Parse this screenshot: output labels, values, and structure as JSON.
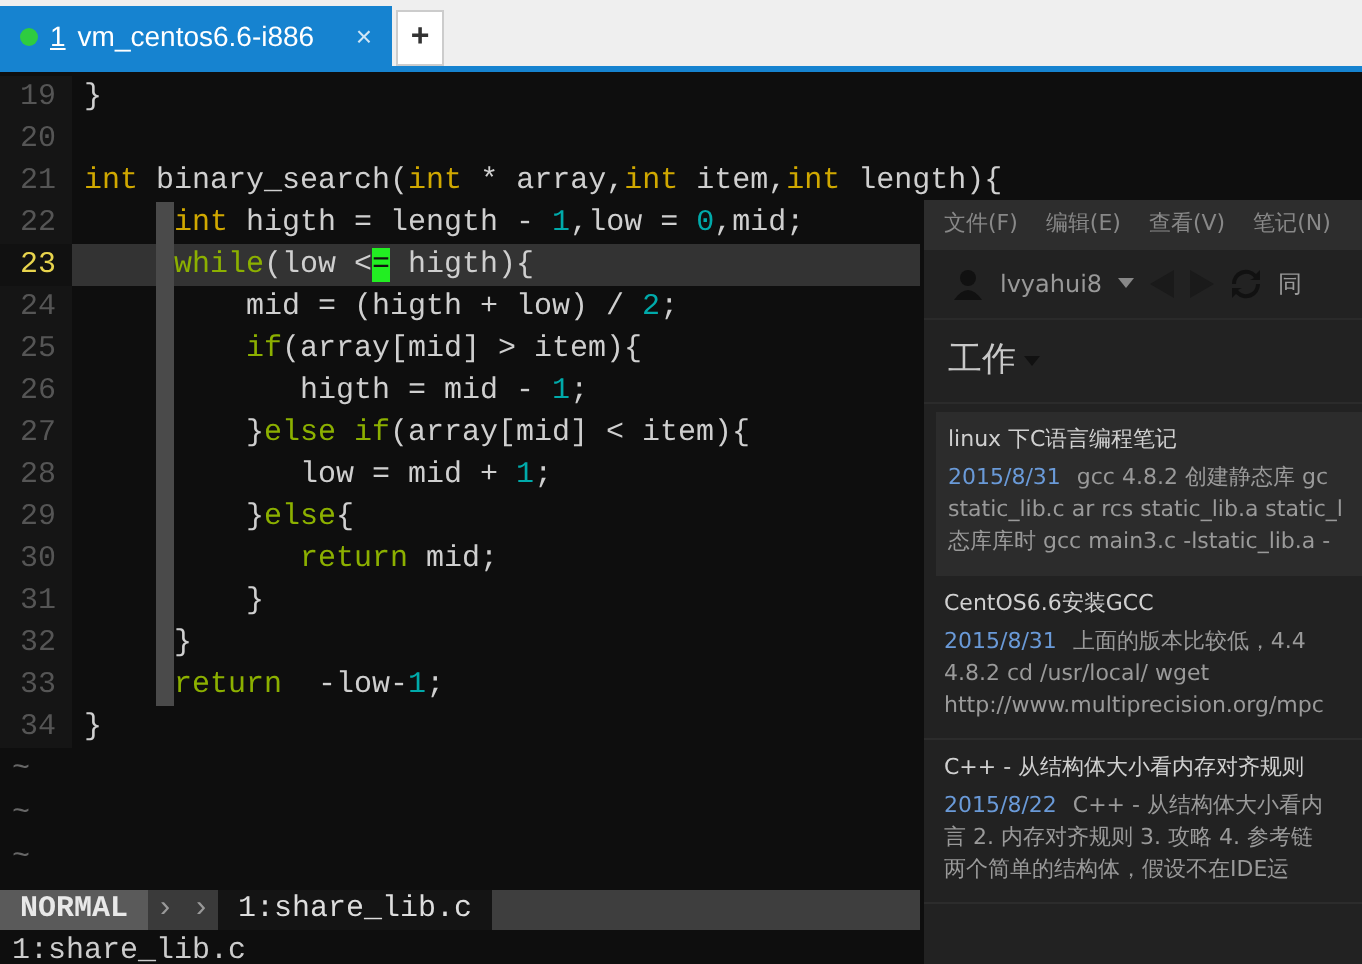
{
  "tabs": [
    {
      "number": "1",
      "label": "vm_centos6.6-i886",
      "selected": true,
      "close": "×"
    },
    {
      "label": "+",
      "selected": false,
      "kind": "new"
    }
  ],
  "editor": {
    "lines": [
      {
        "number": "19",
        "current": false,
        "guide": false,
        "tokens": [
          {
            "t": "}",
            "kind": "plain"
          }
        ]
      },
      {
        "number": "20",
        "current": false,
        "guide": false
      },
      {
        "number": "21",
        "current": false,
        "guide": false,
        "tokens": [
          {
            "t": "int",
            "kind": "type"
          },
          {
            "t": " binary_search(",
            "kind": "plain"
          },
          {
            "t": "int",
            "kind": "type"
          },
          {
            "t": " * array,",
            "kind": "plain"
          },
          {
            "t": "int",
            "kind": "type"
          },
          {
            "t": " item,",
            "kind": "plain"
          },
          {
            "t": "int",
            "kind": "type"
          },
          {
            "t": " length){",
            "kind": "plain"
          }
        ]
      },
      {
        "number": "22",
        "current": false,
        "guide": true,
        "tokens": [
          {
            "t": "     int",
            "kind": "type"
          },
          {
            "t": " higth = length - ",
            "kind": "plain"
          },
          {
            "t": "1",
            "kind": "num"
          },
          {
            "t": ",low = ",
            "kind": "plain"
          },
          {
            "t": "0",
            "kind": "num"
          },
          {
            "t": ",mid;",
            "kind": "plain"
          }
        ]
      },
      {
        "number": "23",
        "current": true,
        "guide": true,
        "tokens": [
          {
            "t": "     while",
            "kind": "kw"
          },
          {
            "t": "(low <",
            "kind": "plain"
          },
          {
            "t": "=",
            "kind": "cursor"
          },
          {
            "t": " higth){",
            "kind": "plain"
          }
        ]
      },
      {
        "number": "24",
        "current": false,
        "guide": true,
        "tokens": [
          {
            "t": "         mid = (higth + low) / ",
            "kind": "plain"
          },
          {
            "t": "2",
            "kind": "num"
          },
          {
            "t": ";",
            "kind": "plain"
          }
        ]
      },
      {
        "number": "25",
        "current": false,
        "guide": true,
        "tokens": [
          {
            "t": "         if",
            "kind": "kw"
          },
          {
            "t": "(array[mid] > item){",
            "kind": "plain"
          }
        ]
      },
      {
        "number": "26",
        "current": false,
        "guide": true,
        "tokens": [
          {
            "t": "            higth = mid - ",
            "kind": "plain"
          },
          {
            "t": "1",
            "kind": "num"
          },
          {
            "t": ";",
            "kind": "plain"
          }
        ]
      },
      {
        "number": "27",
        "current": false,
        "guide": true,
        "tokens": [
          {
            "t": "         }",
            "kind": "plain"
          },
          {
            "t": "else if",
            "kind": "kw"
          },
          {
            "t": "(array[mid] < item){",
            "kind": "plain"
          }
        ]
      },
      {
        "number": "28",
        "current": false,
        "guide": true,
        "tokens": [
          {
            "t": "            low = mid + ",
            "kind": "plain"
          },
          {
            "t": "1",
            "kind": "num"
          },
          {
            "t": ";",
            "kind": "plain"
          }
        ]
      },
      {
        "number": "29",
        "current": false,
        "guide": true,
        "tokens": [
          {
            "t": "         }",
            "kind": "plain"
          },
          {
            "t": "else",
            "kind": "kw"
          },
          {
            "t": "{",
            "kind": "plain"
          }
        ]
      },
      {
        "number": "30",
        "current": false,
        "guide": true,
        "tokens": [
          {
            "t": "            return",
            "kind": "kw"
          },
          {
            "t": " mid;",
            "kind": "plain"
          }
        ]
      },
      {
        "number": "31",
        "current": false,
        "guide": true,
        "tokens": [
          {
            "t": "         }",
            "kind": "plain"
          }
        ]
      },
      {
        "number": "32",
        "current": false,
        "guide": true,
        "tokens": [
          {
            "t": "     }",
            "kind": "plain"
          }
        ]
      },
      {
        "number": "33",
        "current": false,
        "guide": true,
        "tokens": [
          {
            "t": "     return",
            "kind": "kw"
          },
          {
            "t": "  -low-",
            "kind": "plain"
          },
          {
            "t": "1",
            "kind": "num"
          },
          {
            "t": ";",
            "kind": "plain"
          }
        ]
      },
      {
        "number": "34",
        "current": false,
        "guide": false,
        "tokens": [
          {
            "t": "}",
            "kind": "plain"
          }
        ]
      }
    ],
    "tildes": [
      "~",
      "~",
      "~"
    ]
  },
  "statusline": {
    "mode": "NORMAL",
    "separator": "› ›",
    "file": "1:share_lib.c"
  },
  "command_line": "1:share_lib.c",
  "notes_window": {
    "menu": [
      "文件(F)",
      "编辑(E)",
      "查看(V)",
      "笔记(N)"
    ],
    "user": "lvyahui8",
    "sync_label": "同",
    "notebook": "工作",
    "notes": [
      {
        "title": "linux 下C语言编程笔记",
        "date": "2015/8/31",
        "lines": [
          "gcc 4.8.2 创建静态库 gc",
          "static_lib.c ar rcs static_lib.a static_l",
          "态库库时 gcc main3.c -lstatic_lib.a -"
        ],
        "selected": true
      },
      {
        "title": "CentOS6.6安装GCC",
        "date": "2015/8/31",
        "lines": [
          "上面的版本比较低，4.4",
          "4.8.2 cd /usr/local/ wget",
          "http://www.multiprecision.org/mpc"
        ],
        "selected": false
      },
      {
        "title": "C++ - 从结构体大小看内存对齐规则",
        "date": "2015/8/22",
        "lines": [
          "C++ - 从结构体大小看内",
          "言 2. 内存对齐规则 3. 攻略 4. 参考链",
          "两个简单的结构体，假设不在IDE运"
        ],
        "selected": false
      }
    ]
  }
}
